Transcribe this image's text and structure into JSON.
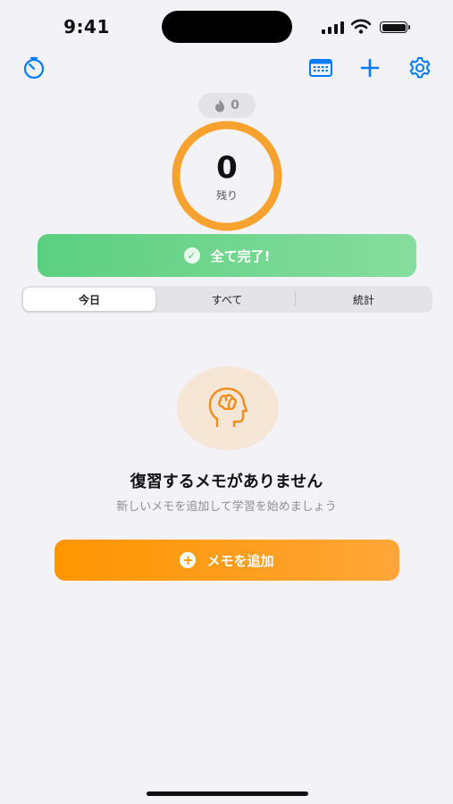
{
  "status_bar": {
    "time": "9:41"
  },
  "nav": {
    "left_icon": "stopwatch-icon",
    "right_icons": [
      "calendar-icon",
      "plus-icon",
      "gear-icon"
    ]
  },
  "streak": {
    "icon": "flame-icon",
    "count": "0"
  },
  "progress_ring": {
    "remaining": "0",
    "label": "残り",
    "fraction_done": 1.0
  },
  "complete_banner": {
    "icon": "checkmark-circle-icon",
    "text": "全て完了!"
  },
  "segmented": {
    "items": [
      "今日",
      "すべて",
      "統計"
    ],
    "selected": "今日"
  },
  "empty_state": {
    "icon": "brain-head-icon",
    "title": "復習するメモがありません",
    "subtitle": "新しいメモを追加して学習を始めましょう"
  },
  "add_button": {
    "icon": "plus-circle-icon",
    "label": "メモを追加"
  },
  "colors": {
    "accent": "#007aff",
    "orange": "#ff9500",
    "green": "#5ccf7f",
    "background": "#f2f2f7"
  }
}
